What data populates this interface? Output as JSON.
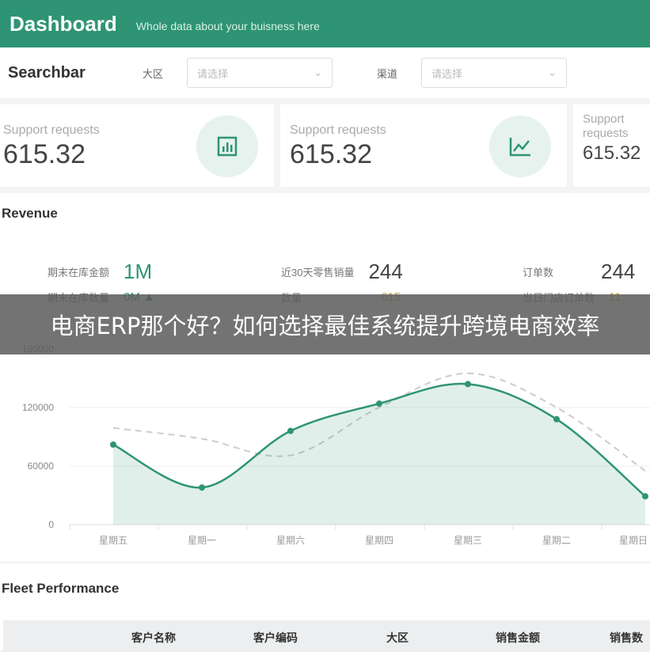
{
  "header": {
    "title": "Dashboard",
    "subtitle": "Whole data about your buisness here"
  },
  "searchbar": {
    "title": "Searchbar",
    "filters": [
      {
        "label": "大区",
        "placeholder": "请选择"
      },
      {
        "label": "渠道",
        "placeholder": "请选择"
      }
    ]
  },
  "cards": [
    {
      "label": "Support requests",
      "value": "615.32",
      "icon": "bar-chart-icon"
    },
    {
      "label": "Support requests",
      "value": "615.32",
      "icon": "line-chart-icon"
    },
    {
      "label": "Support requests",
      "value": "615.32"
    }
  ],
  "revenue": {
    "title": "Revenue",
    "kpis": [
      {
        "label": "期末在库金额",
        "value": "1M",
        "color": "#2e9474"
      },
      {
        "label": "近30天零售销量",
        "value": "244",
        "color": "#444444"
      },
      {
        "label": "订单数",
        "value": "244",
        "color": "#444444"
      },
      {
        "label": "期末在库数量",
        "value": "0M ▲",
        "color": "#2e9474"
      },
      {
        "label": "数量",
        "value": "615",
        "color": "#c9a24a"
      },
      {
        "label": "当日门店订单数",
        "value": "11",
        "color": "#c9a24a"
      }
    ]
  },
  "chart_data": {
    "type": "area",
    "categories": [
      "星期五",
      "星期一",
      "星期六",
      "星期四",
      "星期三",
      "星期二",
      "星期日"
    ],
    "yticks": [
      0,
      60000,
      120000,
      180000
    ],
    "ylim": [
      0,
      180000
    ],
    "grid": true,
    "series": [
      {
        "values": [
          82000,
          38000,
          96000,
          124000,
          144000,
          108000,
          29000
        ],
        "style": "solid-area",
        "color": "#2e9474"
      },
      {
        "values": [
          99000,
          88000,
          71000,
          120000,
          155000,
          120000,
          55000
        ],
        "style": "dashed",
        "color": "#cccccc"
      }
    ]
  },
  "fleet": {
    "title": "Fleet Performance",
    "columns": [
      "客户名称",
      "客户编码",
      "大区",
      "销售金额",
      "销售数"
    ]
  },
  "banner": {
    "text": "电商ERP那个好？如何选择最佳系统提升跨境电商效率"
  }
}
